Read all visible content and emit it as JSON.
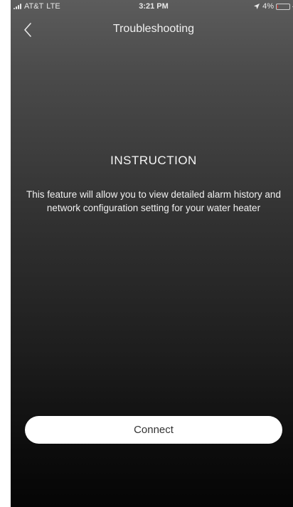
{
  "status_bar": {
    "carrier": "AT&T",
    "network": "LTE",
    "time": "3:21 PM",
    "battery_percent_text": "4%",
    "battery_level": 0.04,
    "icons": [
      "signal-icon",
      "location-icon",
      "battery-icon",
      "charging-icon"
    ]
  },
  "nav": {
    "title": "Troubleshooting",
    "back_icon": "chevron-left-icon"
  },
  "instruction": {
    "heading": "INSTRUCTION",
    "body": "This feature will allow you to view detailed alarm history and network configuration setting for your water heater"
  },
  "connect_button": {
    "label": "Connect"
  },
  "colors": {
    "background_top": "#5c5c5c",
    "background_bottom": "#050505",
    "text": "#f0f0f0",
    "button_bg": "#ffffff",
    "button_text": "#333333",
    "battery_low": "#e53935"
  }
}
